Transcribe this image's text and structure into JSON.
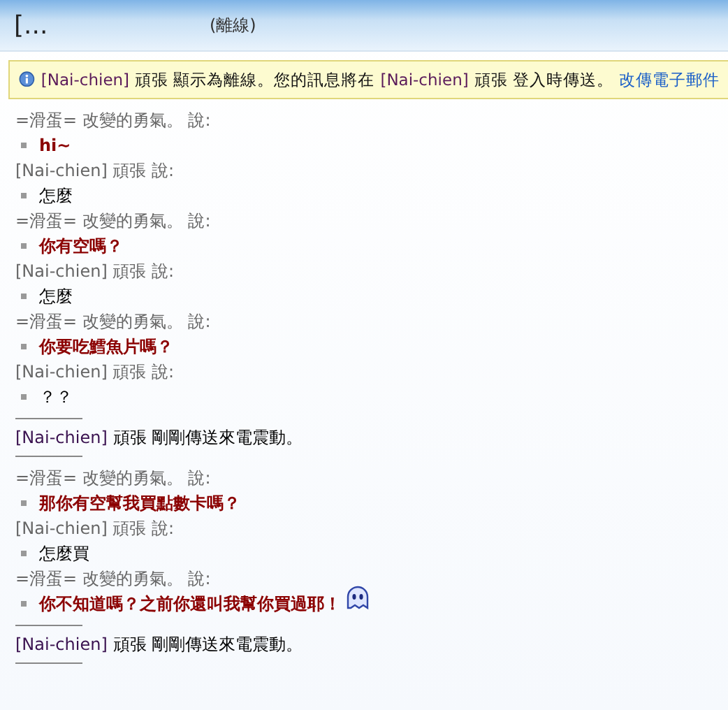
{
  "window": {
    "title": "[...",
    "status": "(離線)"
  },
  "info_bar": {
    "parts": [
      {
        "kind": "name",
        "text": "[Nai-chien]"
      },
      {
        "kind": "text",
        "text": "頑張 顯示為離線。您的訊息將在"
      },
      {
        "kind": "name",
        "text": "[Nai-chien]"
      },
      {
        "kind": "text",
        "text": "頑張 登入時傳送。"
      },
      {
        "kind": "link",
        "text": "改傳電子郵件"
      }
    ]
  },
  "messages": [
    {
      "kind": "speaker",
      "text": "=滑蛋= 改變的勇氣。 說:"
    },
    {
      "kind": "line",
      "text": "hi~",
      "bold": true
    },
    {
      "kind": "speaker",
      "text": "[Nai-chien] 頑張 說:"
    },
    {
      "kind": "line",
      "text": "怎麼",
      "bold": false
    },
    {
      "kind": "speaker",
      "text": "=滑蛋= 改變的勇氣。 說:"
    },
    {
      "kind": "line",
      "text": "你有空嗎？",
      "bold": true
    },
    {
      "kind": "speaker",
      "text": "[Nai-chien] 頑張 說:"
    },
    {
      "kind": "line",
      "text": "怎麼",
      "bold": false
    },
    {
      "kind": "speaker",
      "text": "=滑蛋= 改變的勇氣。 說:"
    },
    {
      "kind": "line",
      "text": "你要吃鱈魚片嗎？",
      "bold": true
    },
    {
      "kind": "speaker",
      "text": "[Nai-chien] 頑張 說:"
    },
    {
      "kind": "line",
      "text": "？？",
      "bold": false
    },
    {
      "kind": "nudge",
      "name": "[Nai-chien]",
      "text": "頑張 剛剛傳送來電震動。"
    },
    {
      "kind": "speaker",
      "text": "=滑蛋= 改變的勇氣。 說:"
    },
    {
      "kind": "line",
      "text": "那你有空幫我買點數卡嗎？",
      "bold": true
    },
    {
      "kind": "speaker",
      "text": "[Nai-chien] 頑張 說:"
    },
    {
      "kind": "line",
      "text": "怎麼買",
      "bold": false
    },
    {
      "kind": "speaker",
      "text": "=滑蛋= 改變的勇氣。 說:"
    },
    {
      "kind": "line",
      "text": "你不知道嗎？之前你還叫我幫你買過耶！",
      "bold": true,
      "emoticon": true
    },
    {
      "kind": "nudge",
      "name": "[Nai-chien]",
      "text": "頑張 剛剛傳送來電震動。"
    }
  ]
}
